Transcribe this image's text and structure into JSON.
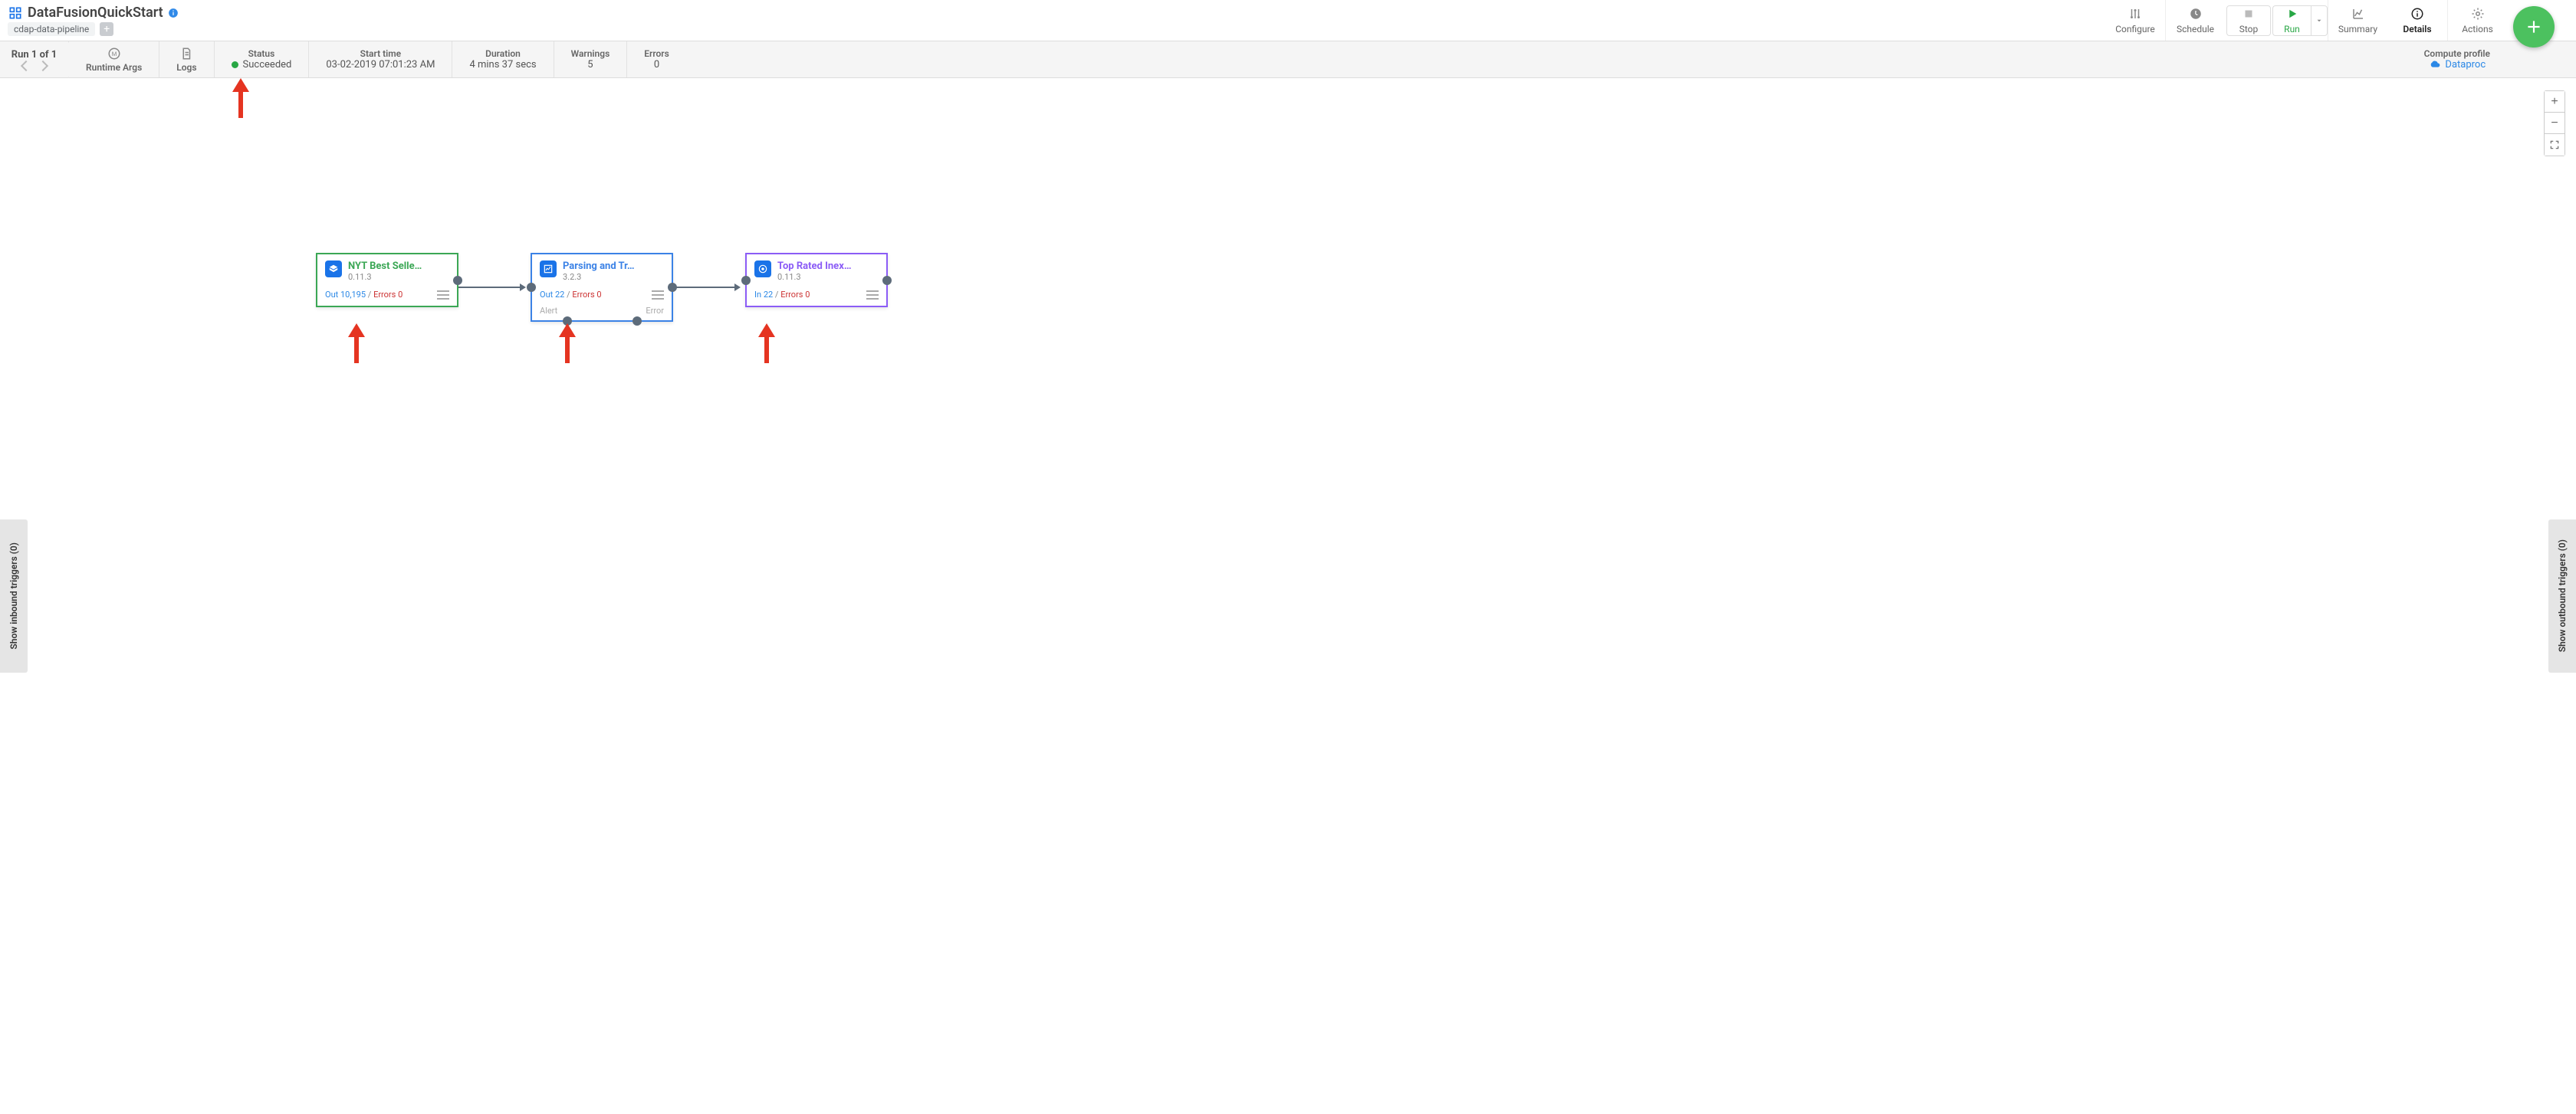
{
  "header": {
    "title": "DataFusionQuickStart",
    "subtitle_chip": "cdap-data-pipeline"
  },
  "toolbar": {
    "configure": "Configure",
    "schedule": "Schedule",
    "stop": "Stop",
    "run": "Run",
    "summary": "Summary",
    "details": "Details",
    "actions": "Actions"
  },
  "runbar": {
    "run_counter": "Run 1 of 1",
    "args": "Runtime Args",
    "logs": "Logs",
    "status_label": "Status",
    "status_value": "Succeeded",
    "start_label": "Start time",
    "start_value": "03-02-2019 07:01:23 AM",
    "duration_label": "Duration",
    "duration_value": "4 mins 37 secs",
    "warnings_label": "Warnings",
    "warnings_value": "5",
    "errors_label": "Errors",
    "errors_value": "0",
    "compute_label": "Compute profile",
    "compute_value": "Dataproc"
  },
  "side": {
    "inbound": "Show inbound triggers (0)",
    "outbound": "Show outbound triggers (0)"
  },
  "nodes": [
    {
      "id": "n1",
      "title": "NYT Best Selle…",
      "version": "0.11.3",
      "io": {
        "out_label": "Out",
        "out": "10,195",
        "err_label": "Errors",
        "err": "0"
      }
    },
    {
      "id": "n2",
      "title": "Parsing and Tr…",
      "version": "3.2.3",
      "io": {
        "out_label": "Out",
        "out": "22",
        "err_label": "Errors",
        "err": "0"
      },
      "foot_left": "Alert",
      "foot_right": "Error"
    },
    {
      "id": "n3",
      "title": "Top Rated Inex…",
      "version": "0.11.3",
      "io": {
        "in_label": "In",
        "in": "22",
        "err_label": "Errors",
        "err": "0"
      }
    }
  ]
}
